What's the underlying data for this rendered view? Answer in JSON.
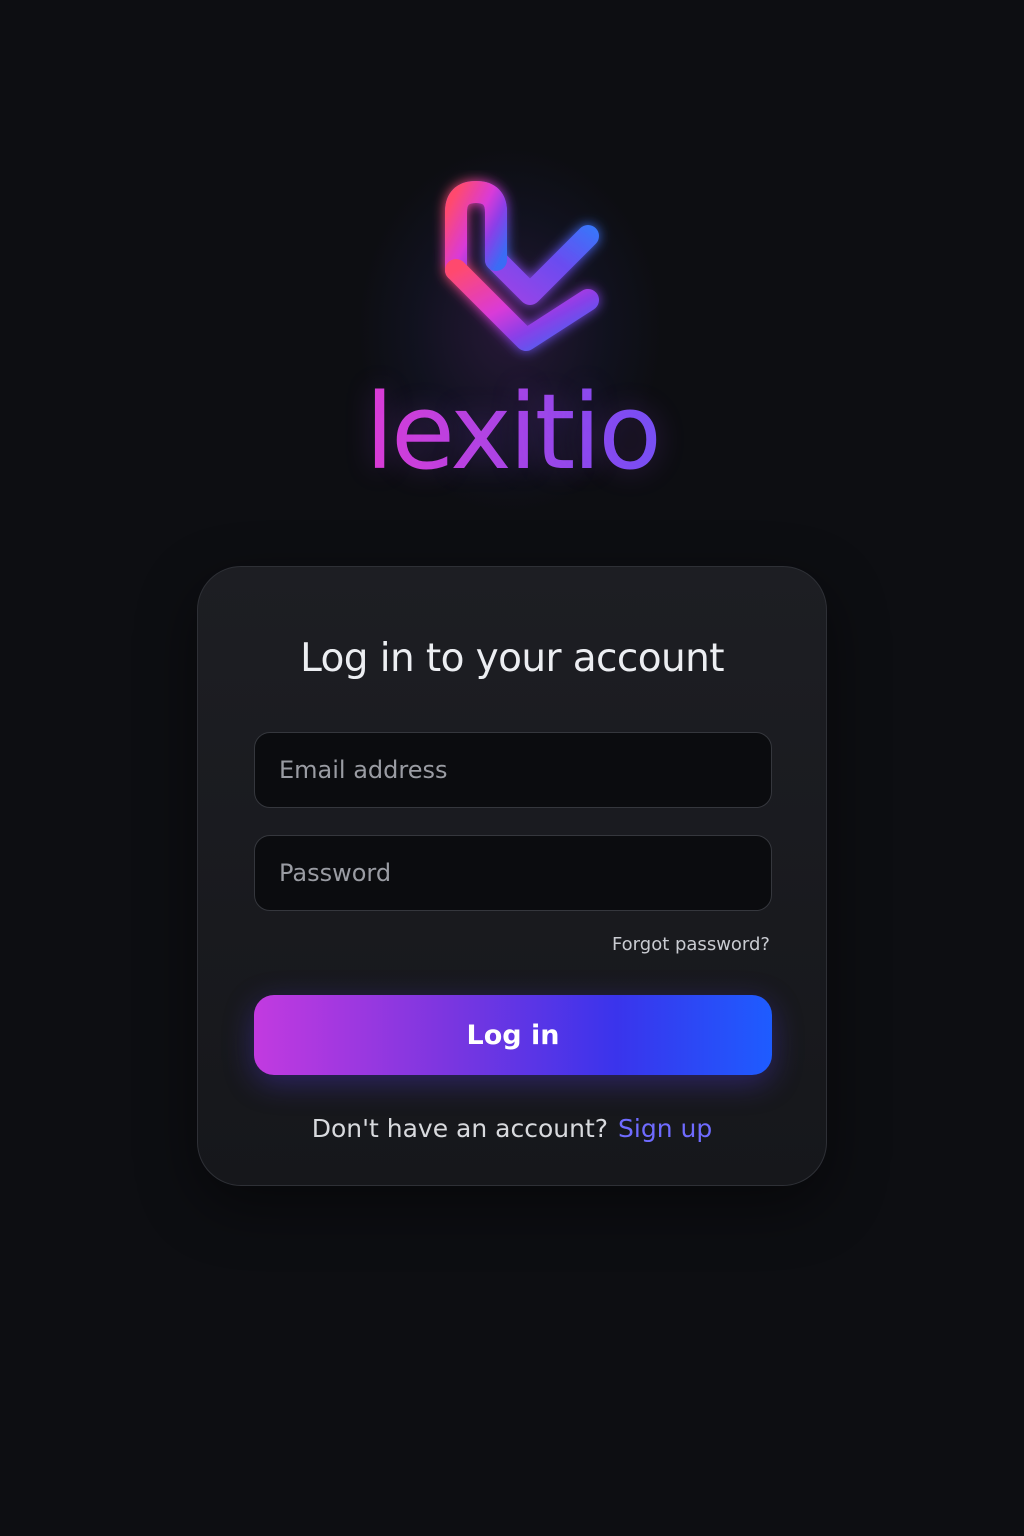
{
  "brand": {
    "wordmark": "lexitio",
    "logo_icon": "checkmark-loop-logo-icon",
    "gradient_colors": [
      "#ff4d6d",
      "#e23bd3",
      "#7a4df2",
      "#1f8bff"
    ]
  },
  "login_card": {
    "title": "Log in to your account",
    "email_placeholder": "Email address",
    "password_placeholder": "Password",
    "forgot_password_label": "Forgot password?",
    "login_button_label": "Log in",
    "signup_prompt": "Don't have an account?",
    "signup_link_label": "Sign up"
  },
  "colors": {
    "background": "#0d0e12",
    "card_background": "#1a1b20",
    "accent_link": "#6f6bff",
    "button_gradient_start": "#c23ae0",
    "button_gradient_end": "#1e5cff"
  }
}
